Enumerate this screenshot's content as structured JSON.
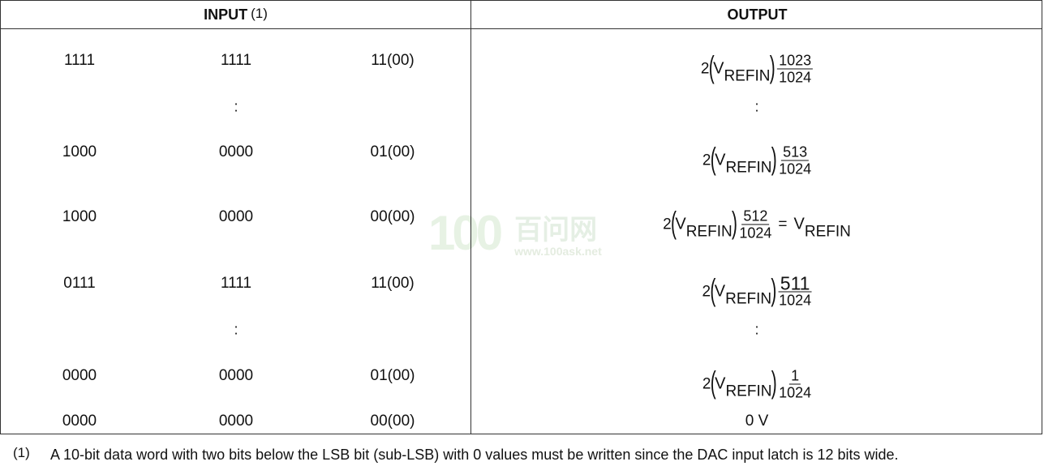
{
  "header": {
    "input_label": "INPUT",
    "input_note_ref": "(1)",
    "output_label": "OUTPUT"
  },
  "rows": [
    {
      "b1": "1111",
      "b2": "1111",
      "b3": "11(00)",
      "out_coef": "2",
      "out_v": "V",
      "out_sub": "REFIN",
      "out_num": "1023",
      "out_den": "1024"
    },
    {
      "ellipsis": ":",
      "out_ellipsis": ":"
    },
    {
      "b1": "1000",
      "b2": "0000",
      "b3": "01(00)",
      "out_coef": "2",
      "out_v": "V",
      "out_sub": "REFIN",
      "out_num": "513",
      "out_den": "1024"
    },
    {
      "b1": "1000",
      "b2": "0000",
      "b3": "00(00)",
      "out_coef": "2",
      "out_v": "V",
      "out_sub": "REFIN",
      "out_num": "512",
      "out_den": "1024",
      "out_eq": "=",
      "out_v2": "V",
      "out_sub2": "REFIN"
    },
    {
      "b1": "0111",
      "b2": "1111",
      "b3": "11(00)",
      "out_coef": "2",
      "out_v": "V",
      "out_sub": "REFIN",
      "out_num": "511",
      "out_den": "1024"
    },
    {
      "ellipsis": ":",
      "out_ellipsis": ":"
    },
    {
      "b1": "0000",
      "b2": "0000",
      "b3": "01(00)",
      "out_coef": "2",
      "out_v": "V",
      "out_sub": "REFIN",
      "out_num": "1",
      "out_den": "1024"
    },
    {
      "b1": "0000",
      "b2": "0000",
      "b3": "00(00)",
      "out_text": "0 V"
    }
  ],
  "footnote": {
    "marker": "(1)",
    "text": "A 10-bit data word with two bits below the LSB bit (sub-LSB) with 0 values must be written since the DAC input latch is 12 bits wide."
  },
  "watermark": {
    "logo": "100",
    "cn": "百问网",
    "url": "www.100ask.net"
  },
  "parens": {
    "open": "(",
    "close": ")"
  }
}
